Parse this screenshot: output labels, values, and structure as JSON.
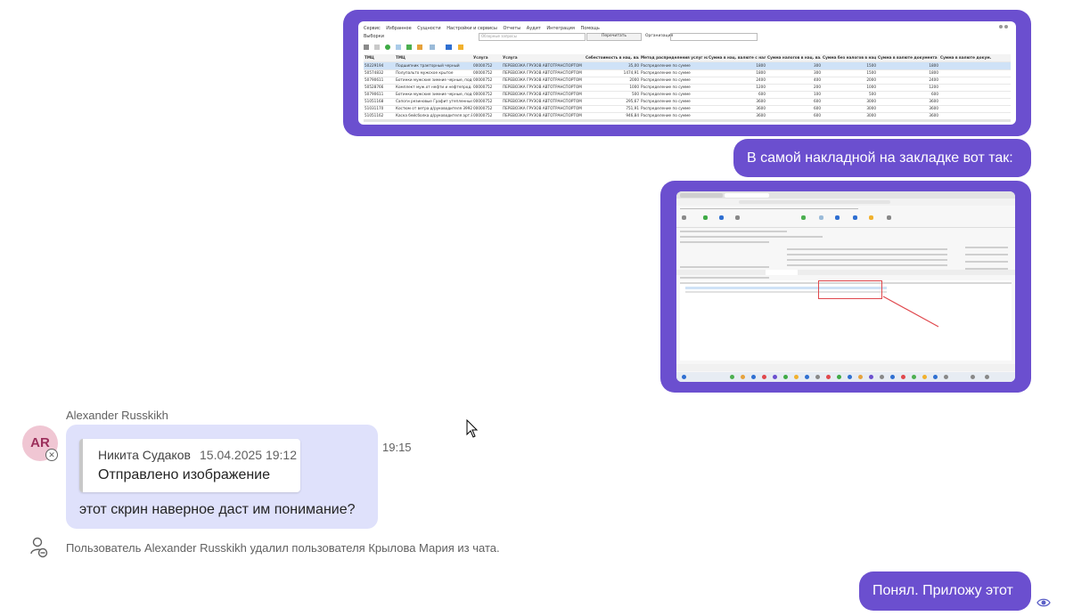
{
  "messages": {
    "outgoing_text_1": "В самой накладной на закладке вот так:",
    "outgoing_text_2": "Понял. Приложу этот"
  },
  "incoming": {
    "sender": "Alexander Russkikh",
    "avatar_initials": "AR",
    "time": "19:15",
    "quote_author": "Никита Судаков",
    "quote_time": "15.04.2025 19:12",
    "quote_text": "Отправлено изображение",
    "text": "этот скрин наверное даст им понимание?"
  },
  "system_message": "Пользователь Alexander Russkikh удалил пользователя Крылова Мария из чата.",
  "screenshot1": {
    "menu": [
      "Сервис",
      "Избранное",
      "Сущности",
      "Настройки и сервисы",
      "Отчеты",
      "Аудит",
      "Интеграция",
      "Помощь"
    ],
    "filter_label": "Выборки",
    "filter_placeholder": "Обзорные запросы",
    "reread_button": "Перечитать",
    "org_label": "Организация",
    "columns": [
      "ТМЦ",
      "ТМЦ",
      "Услуга",
      "Услуга",
      "Себестоимость в нац. вал.",
      "Метод распределения услуг на ТМЦ",
      "Сумма в нац. валюте с налог.",
      "Сумма налогов в нац. вал.",
      "Сумма без налогов в нац. вал.",
      "Сумма в валюте документа с налог.",
      "Сумма в валюте докум."
    ],
    "rows": [
      [
        "50229194",
        "Подшипник тракторный черный",
        "00000752",
        "ПЕРЕВОЗКА ГРУЗОВ АВТОТРАНСПОРТОМ",
        "35,00",
        "Распределение по сумме",
        "1800",
        "300",
        "1500",
        "1800"
      ],
      [
        "50574832",
        "Полупальто мужское крытое",
        "00000752",
        "ПЕРЕВОЗКА ГРУЗОВ АВТОТРАНСПОРТОМ",
        "1474,91",
        "Распределение по сумме",
        "1800",
        "300",
        "1500",
        "1800"
      ],
      [
        "50790611",
        "Ботинки мужские зимние черные, подошва ...",
        "00000752",
        "ПЕРЕВОЗКА ГРУЗОВ АВТОТРАНСПОРТОМ",
        "2000",
        "Распределение по сумме",
        "2400",
        "400",
        "2000",
        "2400"
      ],
      [
        "50528766",
        "Комплект муж.от нефти и нефтепрод.С.630",
        "00000752",
        "ПЕРЕВОЗКА ГРУЗОВ АВТОТРАНСПОРТОМ",
        "1000",
        "Распределение по сумме",
        "1200",
        "200",
        "1000",
        "1200"
      ],
      [
        "50790611",
        "Ботинки мужские зимние черные, подошва ...",
        "00000752",
        "ПЕРЕВОЗКА ГРУЗОВ АВТОТРАНСПОРТОМ",
        "500",
        "Распределение по сумме",
        "600",
        "100",
        "500",
        "600"
      ],
      [
        "51051168",
        "Сапоги резиновые Графит утепленные с ...",
        "00000752",
        "ПЕРЕВОЗКА ГРУЗОВ АВТОТРАНСПОРТОМ",
        "295,67",
        "Распределение по сумме",
        "3600",
        "600",
        "3000",
        "3600"
      ],
      [
        "51031170",
        "Костюм от ветра д/руководителя 3992",
        "00000752",
        "ПЕРЕВОЗКА ГРУЗОВ АВТОТРАНСПОРТОМ",
        "751,91",
        "Распределение по сумме",
        "3600",
        "600",
        "3000",
        "3600"
      ],
      [
        "51051162",
        "Каска бейсболка д/руководителя арт.8154",
        "00000752",
        "ПЕРЕВОЗКА ГРУЗОВ АВТОТРАНСПОРТОМ",
        "946,84",
        "Распределение по сумме",
        "3600",
        "600",
        "3000",
        "3600"
      ]
    ]
  },
  "colors": {
    "outgoing_bubble": "#6b4fcf",
    "incoming_bubble": "#dfe1fb",
    "avatar_bg": "#f0c6d3",
    "highlight_red": "#e0484d"
  }
}
